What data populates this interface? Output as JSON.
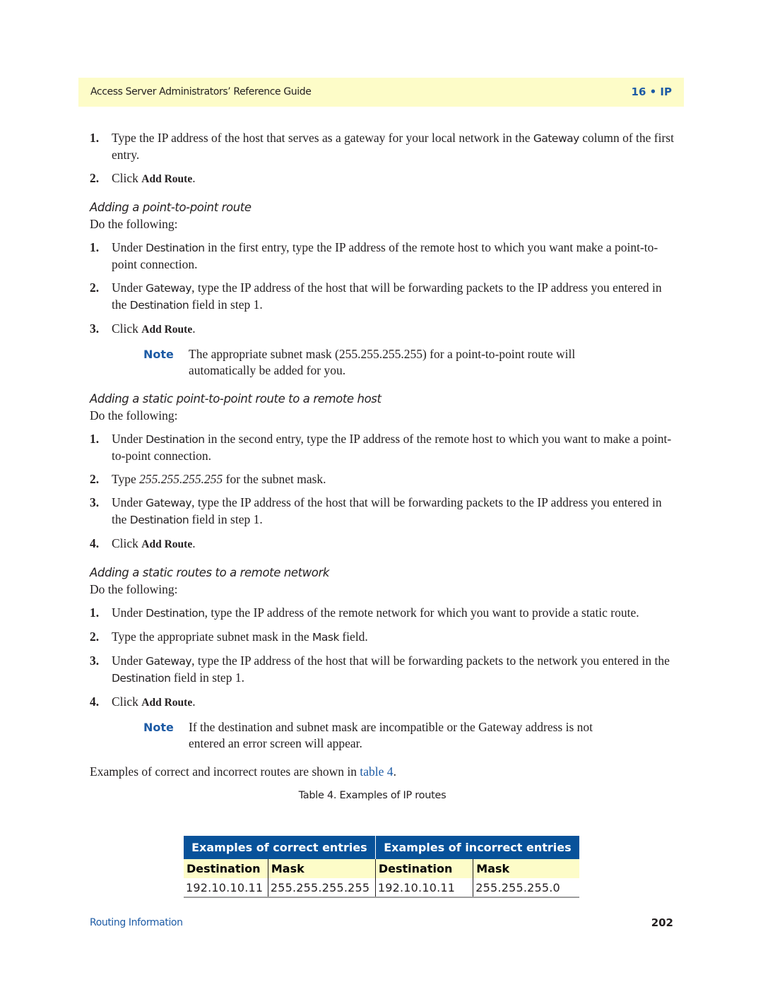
{
  "header": {
    "title": "Access Server Administrators’ Reference Guide",
    "chapter": "16 • IP"
  },
  "intro_steps": [
    {
      "num": "1.",
      "pre": "Type the IP address of the host that serves as a gateway for your local network in the ",
      "ui": "Gateway",
      "post": " column of the first entry."
    },
    {
      "num": "2.",
      "pre": "Click ",
      "bold": "Add Route",
      "post": "."
    }
  ],
  "sections": [
    {
      "heading": "Adding a point-to-point route",
      "intro": "Do the following:",
      "steps": [
        {
          "num": "1.",
          "pre": "Under ",
          "ui": "Destination",
          "post": " in the first entry, type the IP address of the remote host to which you want make a point-to-point connection."
        },
        {
          "num": "2.",
          "pre": "Under ",
          "ui": "Gateway",
          "mid": ", type the IP address of the host that will be forwarding packets to the IP address you entered in the ",
          "ui2": "Destination",
          "post": " field in step 1."
        },
        {
          "num": "3.",
          "pre": "Click ",
          "bold": "Add Route",
          "post": "."
        }
      ],
      "note": {
        "label": "Note",
        "text": "The appropriate subnet mask (255.255.255.255) for a point-to-point route will automatically be added for you."
      }
    },
    {
      "heading": "Adding a static point-to-point route to a remote host",
      "intro": "Do the following:",
      "steps": [
        {
          "num": "1.",
          "pre": "Under ",
          "ui": "Destination",
          "post": " in the second entry, type the IP address of the remote host to which you want to make a point-to-point connection."
        },
        {
          "num": "2.",
          "pre": "Type ",
          "ital": "255.255.255.255",
          "post": " for the subnet mask."
        },
        {
          "num": "3.",
          "pre": "Under ",
          "ui": "Gateway",
          "mid": ", type the IP address of the host that will be forwarding packets to the IP address you entered in the ",
          "ui2": "Destination",
          "post": " field in step 1."
        },
        {
          "num": "4.",
          "pre": "Click ",
          "bold": "Add Route",
          "post": "."
        }
      ]
    },
    {
      "heading": "Adding a static routes to a remote network",
      "intro": "Do the following:",
      "steps": [
        {
          "num": "1.",
          "pre": "Under ",
          "ui": "Destination",
          "post": ", type the IP address of the remote network for which you want to provide a static route."
        },
        {
          "num": "2.",
          "pre": "Type the appropriate subnet mask in the ",
          "ui": "Mask",
          "post": " field."
        },
        {
          "num": "3.",
          "pre": "Under ",
          "ui": "Gateway",
          "mid": ", type the IP address of the host that will be forwarding packets to the network you entered in the ",
          "ui2": "Destination",
          "post": " field in step 1."
        },
        {
          "num": "4.",
          "pre": "Click ",
          "bold": "Add Route",
          "post": "."
        }
      ],
      "note": {
        "label": "Note",
        "text": "If the destination and subnet mask are incompatible or the Gateway address is not entered an error screen will appear."
      }
    }
  ],
  "closing": {
    "pre": "Examples of correct and incorrect routes are shown in ",
    "link": "table 4",
    "post": "."
  },
  "table": {
    "caption": "Table 4. Examples of IP routes",
    "groups": [
      "Examples of correct entries",
      "Examples of incorrect entries"
    ],
    "columns": [
      "Destination",
      "Mask",
      "Destination",
      "Mask"
    ],
    "rows": [
      [
        "192.10.10.11",
        "255.255.255.255",
        "192.10.10.11",
        "255.255.255.0"
      ]
    ]
  },
  "footer": {
    "section": "Routing Information",
    "page": "202"
  }
}
